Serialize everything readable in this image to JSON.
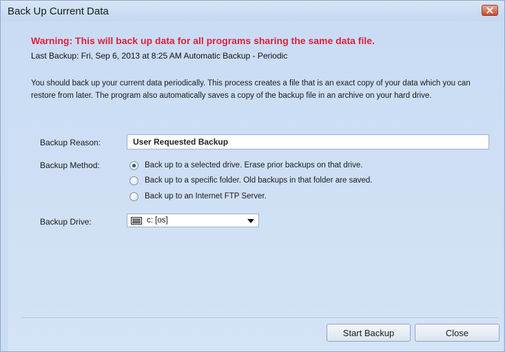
{
  "window": {
    "title": "Back Up Current Data"
  },
  "header": {
    "warning": "Warning:  This will back up data for all programs sharing the same data file.",
    "last_backup": "Last Backup: Fri, Sep 6, 2013 at 8:25 AM  Automatic Backup - Periodic"
  },
  "description": "You should back up your current data periodically. This process creates a file that is an exact copy of your data which you can restore from later.  The program also automatically saves a copy of the backup file in an archive on your hard drive.",
  "form": {
    "reason_label": "Backup Reason:",
    "reason_value": "User Requested Backup",
    "method_label": "Backup Method:",
    "methods": [
      {
        "label": "Back up to a selected drive.  Erase prior backups on that drive.",
        "selected": true
      },
      {
        "label": "Back up to a specific folder.  Old backups in that folder are saved.",
        "selected": false
      },
      {
        "label": "Back up to an Internet FTP Server.",
        "selected": false
      }
    ],
    "drive_label": "Backup Drive:",
    "drive_value": "c: [os]",
    "drive_icon": "drive-icon"
  },
  "buttons": {
    "start_backup": "Start Backup",
    "close": "Close"
  },
  "colors": {
    "warning": "#e0203a",
    "background": "#c9dcf3",
    "close_button": "#c74a33"
  }
}
